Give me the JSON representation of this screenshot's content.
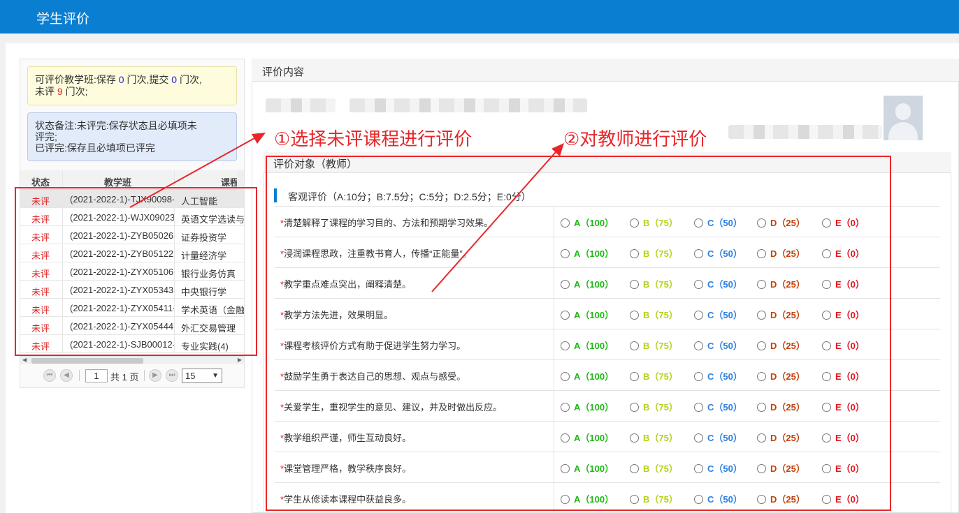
{
  "app": {
    "title": "学生评价"
  },
  "left": {
    "notice1": {
      "prefix": "可评价教学班:保存",
      "saved": "0",
      "mid1": "门次,提交",
      "submitted": "0",
      "mid2": "门次,",
      "line2_prefix": "未评",
      "unrated": "9",
      "suffix": "门次;"
    },
    "notice2": {
      "line1": "状态备注:未评完:保存状态且必填项未",
      "line2": "评完;",
      "line3": "已评完:保存且必填项已评完"
    },
    "grid": {
      "headers": {
        "status": "状态",
        "class": "教学班",
        "course": "课程"
      },
      "rows": [
        {
          "status": "未评",
          "class": "(2021-2022-1)-TJX90098-",
          "course": "人工智能"
        },
        {
          "status": "未评",
          "class": "(2021-2022-1)-WJX09023",
          "course": "英语文学选读与"
        },
        {
          "status": "未评",
          "class": "(2021-2022-1)-ZYB05026",
          "course": "证券投资学"
        },
        {
          "status": "未评",
          "class": "(2021-2022-1)-ZYB05122",
          "course": "计量经济学"
        },
        {
          "status": "未评",
          "class": "(2021-2022-1)-ZYX05106",
          "course": "银行业务仿真"
        },
        {
          "status": "未评",
          "class": "(2021-2022-1)-ZYX05343",
          "course": "中央银行学"
        },
        {
          "status": "未评",
          "class": "(2021-2022-1)-ZYX05411-",
          "course": "学术英语（金融"
        },
        {
          "status": "未评",
          "class": "(2021-2022-1)-ZYX05444",
          "course": "外汇交易管理"
        },
        {
          "status": "未评",
          "class": "(2021-2022-1)-SJB00012-",
          "course": "专业实践(4)"
        }
      ]
    },
    "pager": {
      "page": "1",
      "total": "共 1 页",
      "page_size": "15",
      "first": "⏮",
      "prev": "◀",
      "next": "▶",
      "last": "⏭"
    }
  },
  "right": {
    "header": "评价内容",
    "section_title": "评价对象（教师）",
    "subheading": "客观评价（A:10分；B:7.5分；C:5分；D:2.5分；E:0分）",
    "options": [
      {
        "label": "A（100）",
        "color": "#1fb814"
      },
      {
        "label": "B（75）",
        "color": "#b5d11a"
      },
      {
        "label": "C（50）",
        "color": "#2a7fe0"
      },
      {
        "label": "D（25）",
        "color": "#c2410c"
      },
      {
        "label": "E（0）",
        "color": "#e0141e"
      }
    ],
    "questions": [
      "清楚解释了课程的学习目的、方法和预期学习效果。",
      "浸润课程思政，注重教书育人，传播“正能量”。",
      "教学重点难点突出，阐释清楚。",
      "教学方法先进，效果明显。",
      "课程考核评价方式有助于促进学生努力学习。",
      "鼓励学生勇于表达自己的思想、观点与感受。",
      "关爱学生，重视学生的意见、建议，并及时做出反应。",
      "教学组织严谨，师生互动良好。",
      "课堂管理严格，教学秩序良好。",
      "学生从修读本课程中获益良多。"
    ],
    "required_mark": "*"
  },
  "annotations": {
    "callout1": "①选择未评课程进行评价",
    "callout2": "②对教师进行评价",
    "color": "#e8262a"
  }
}
